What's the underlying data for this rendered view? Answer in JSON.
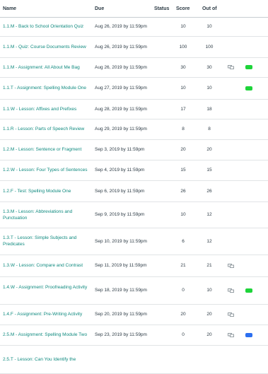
{
  "header": {
    "name": "Name",
    "due": "Due",
    "status": "Status",
    "score": "Score",
    "out_of": "Out of"
  },
  "rows": [
    {
      "name": "1.1.M - Back to School Orientation Quiz",
      "due": "Aug 26, 2019 by 11:59pm",
      "score": "10",
      "out_of": "10"
    },
    {
      "name": "1.1.M - Quiz: Course Documents Review",
      "due": "Aug 26, 2019 by 11:59pm",
      "score": "100",
      "out_of": "100"
    },
    {
      "name": "1.1.M - Assignment: All About Me Bag",
      "due": "Aug 26, 2019 by 11:59pm",
      "score": "30",
      "out_of": "30",
      "comment": true,
      "marker": "green"
    },
    {
      "name": "1.1.T - Assignment: Spelling Module One",
      "due": "Aug 27, 2019 by 11:59pm",
      "score": "10",
      "out_of": "10",
      "marker": "green"
    },
    {
      "name": "1.1.W - Lesson: Affixes and Prefixes",
      "due": "Aug 28, 2019 by 11:59pm",
      "score": "17",
      "out_of": "18"
    },
    {
      "name": "1.1.R - Lesson: Parts of Speech Review",
      "due": "Aug 29, 2019 by 11:59pm",
      "score": "8",
      "out_of": "8"
    },
    {
      "name": "1.2.M - Lesson: Sentence or Fragment",
      "due": "Sep 3, 2019 by 11:59pm",
      "score": "20",
      "out_of": "20"
    },
    {
      "name": "1.2.W - Lesson: Four Types of Sentences",
      "due": "Sep 4, 2019 by 11:59pm",
      "score": "15",
      "out_of": "15"
    },
    {
      "name": "1.2.F - Test: Spelling Module One",
      "due": "Sep 6, 2019 by 11:59pm",
      "score": "26",
      "out_of": "26"
    },
    {
      "name": "1.3.M - Lesson: Abbreviations and Punctuation",
      "due": "Sep 9, 2019 by 11:59pm",
      "score": "10",
      "out_of": "12"
    },
    {
      "name": "1.3.T - Lesson: Simple Subjects and Predicates",
      "due": "Sep 10, 2019 by 11:59pm",
      "score": "6",
      "out_of": "12"
    },
    {
      "name": "1.3.W - Lesson: Compare and Contrast",
      "due": "Sep 11, 2019 by 11:59pm",
      "score": "21",
      "out_of": "21",
      "comment": true
    },
    {
      "name": "1.4.W - Assignment: Proofreading Activity",
      "due": "Sep 18, 2019 by 11:59pm",
      "score": "0",
      "out_of": "10",
      "comment": true,
      "marker": "green"
    },
    {
      "name": "1.4.F - Assignment: Pre-Writing Activity",
      "due": "Sep 20, 2019 by 11:59pm",
      "score": "20",
      "out_of": "20",
      "comment": true
    },
    {
      "name": "2.5.M - Assignment: Spelling Module Two",
      "due": "Sep 23, 2019 by 11:59pm",
      "score": "0",
      "out_of": "20",
      "comment": true,
      "marker": "blue"
    },
    {
      "name": "2.5.T - Lesson: Can You Identify the",
      "due": "",
      "score": "",
      "out_of": ""
    }
  ],
  "colors": {
    "link": "#0f8a7f",
    "text": "#2d3b45",
    "green_marker": "#1ed43a",
    "blue_marker": "#2c6ff0",
    "comment_icon": "#7b868d"
  },
  "icons": {
    "comment": "comment-icon",
    "rubric_marker": "rubric-marker-icon"
  }
}
